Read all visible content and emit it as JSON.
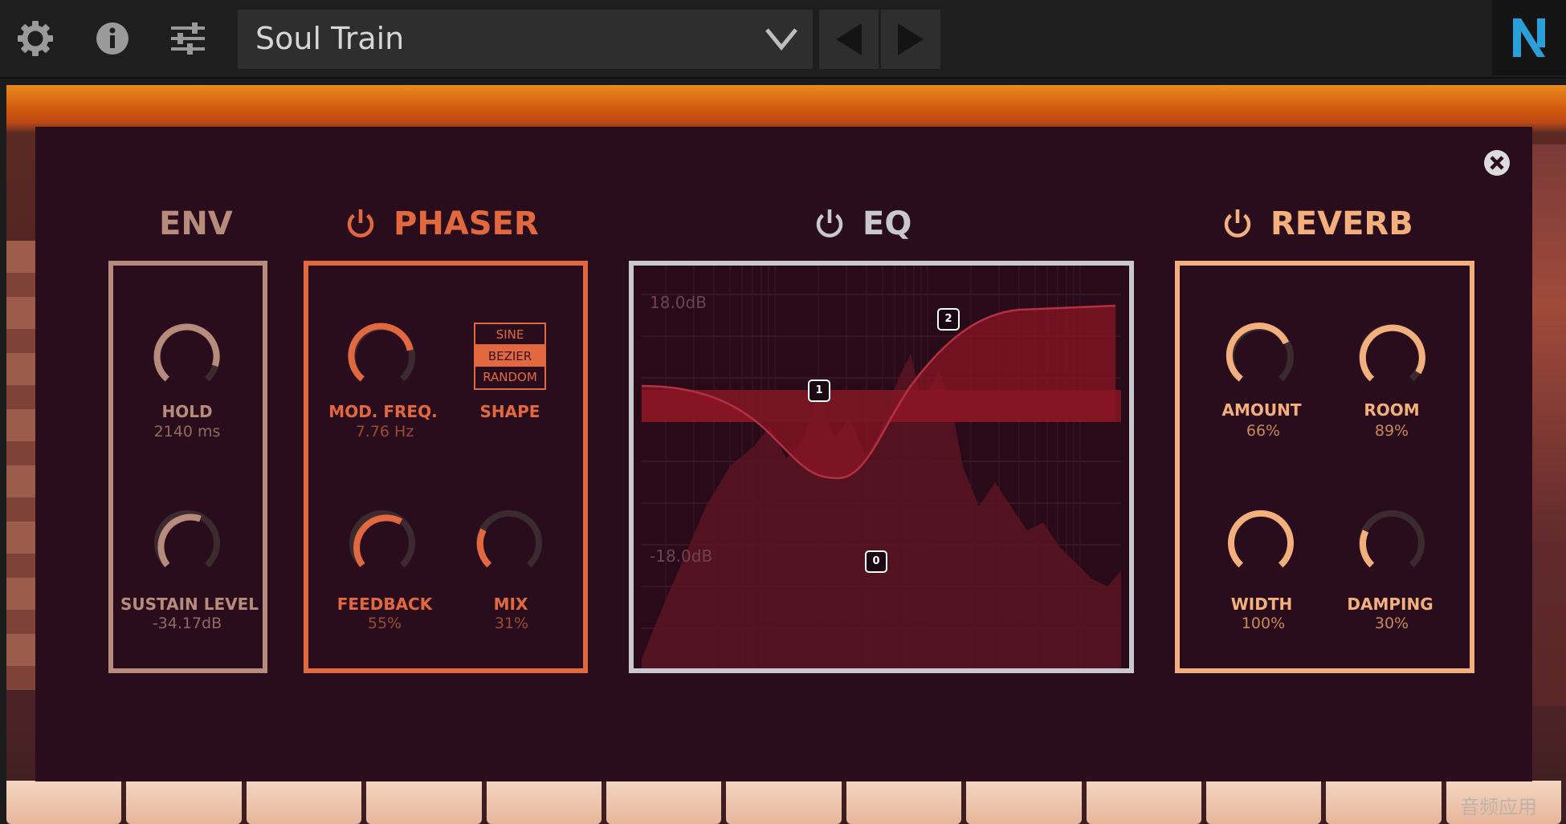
{
  "toolbar": {
    "settings_icon": "gear-icon",
    "info_icon": "info-icon",
    "mixer_icon": "sliders-icon",
    "preset_name": "Soul Train",
    "prev_icon": "triangle-left-icon",
    "next_icon": "triangle-right-icon",
    "logo": "N"
  },
  "panel": {
    "close_icon": "close-circle-icon",
    "env": {
      "title": "ENV",
      "color": "#b88c7c",
      "knobs": [
        {
          "label": "HOLD",
          "value": "2140 ms",
          "level": 0.85
        },
        {
          "label": "SUSTAIN LEVEL",
          "value": "-34.17dB",
          "level": 0.55
        }
      ]
    },
    "phaser": {
      "title": "PHASER",
      "color": "#e2693f",
      "knobs": [
        {
          "label": "MOD. FREQ.",
          "value": "7.76 Hz",
          "level": 0.75
        },
        {
          "label": "FEEDBACK",
          "value": "55%",
          "level": 0.6
        },
        {
          "label": "MIX",
          "value": "31%",
          "level": 0.3
        }
      ],
      "shape": {
        "label": "SHAPE",
        "options": [
          "SINE",
          "BEZIER",
          "RANDOM"
        ],
        "selected": "BEZIER"
      }
    },
    "eq": {
      "title": "EQ",
      "color": "#c9c9cd",
      "db_top": "18.0dB",
      "db_bottom": "-18.0dB",
      "nodes": [
        "1",
        "2",
        "0"
      ]
    },
    "reverb": {
      "title": "REVERB",
      "color": "#f4b07c",
      "knobs": [
        {
          "label": "AMOUNT",
          "value": "66%",
          "level": 0.66
        },
        {
          "label": "ROOM",
          "value": "89%",
          "level": 0.89
        },
        {
          "label": "WIDTH",
          "value": "100%",
          "level": 1.0
        },
        {
          "label": "DAMPING",
          "value": "30%",
          "level": 0.3
        }
      ]
    }
  },
  "watermark": "音频应用"
}
